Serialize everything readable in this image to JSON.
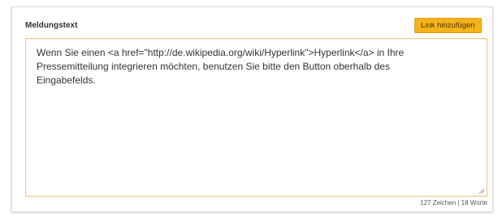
{
  "form": {
    "label": "Meldungstext",
    "add_link_label": "Link hinzufügen",
    "text": "Wenn Sie einen <a href=\"http://de.wikipedia.org/wiki/Hyperlink\">Hyperlink</a> in Ihre\nPressemitteilung integrieren möchten, benutzen Sie bitte den Button oberhalb des\nEingabefelds.",
    "counter": "127 Zeichen | 18 Worte"
  },
  "colors": {
    "button_bg": "#f5b21a",
    "editor_border": "#f4c87e"
  },
  "icons": {
    "resize": "resize-grip-icon"
  }
}
